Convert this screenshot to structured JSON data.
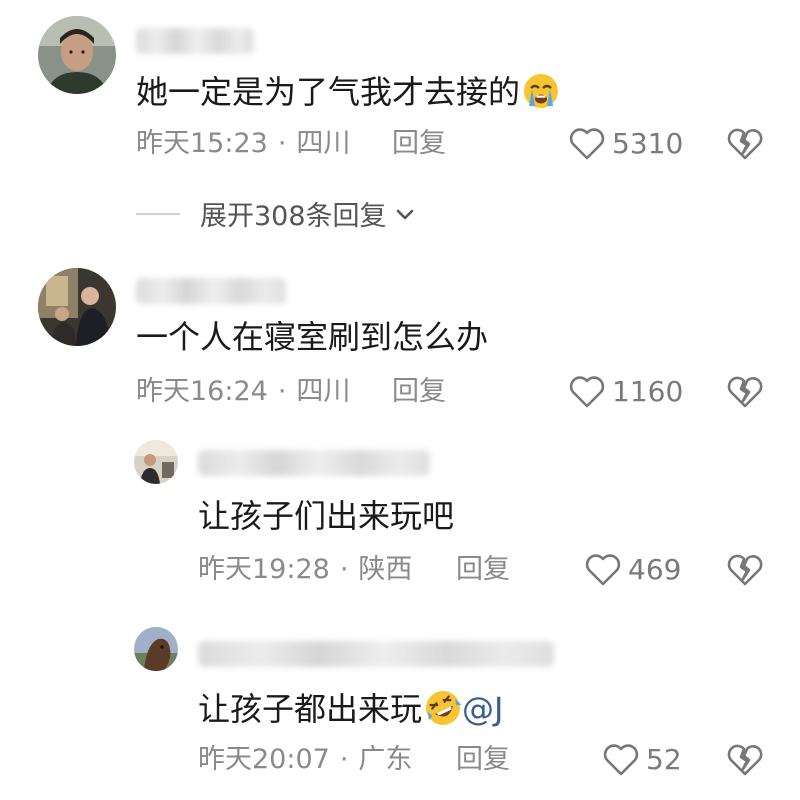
{
  "comments": [
    {
      "text": "她一定是为了气我才去接的",
      "emoji": "loudly-crying-face",
      "time": "昨天15:23",
      "location": "四川",
      "reply_label": "回复",
      "likes": "5310",
      "expand_label": "展开308条回复"
    },
    {
      "text": "一个人在寝室刷到怎么办",
      "time": "昨天16:24",
      "location": "四川",
      "reply_label": "回复",
      "likes": "1160"
    }
  ],
  "replies": [
    {
      "text": "让孩子们出来玩吧",
      "time": "昨天19:28",
      "location": "陕西",
      "reply_label": "回复",
      "likes": "469"
    },
    {
      "text": "让孩子都出来玩",
      "emoji": "rolling-on-floor-laughing",
      "mention": "@J",
      "time": "昨天20:07",
      "location": "广东",
      "reply_label": "回复",
      "likes": "52"
    }
  ],
  "separator": "·"
}
